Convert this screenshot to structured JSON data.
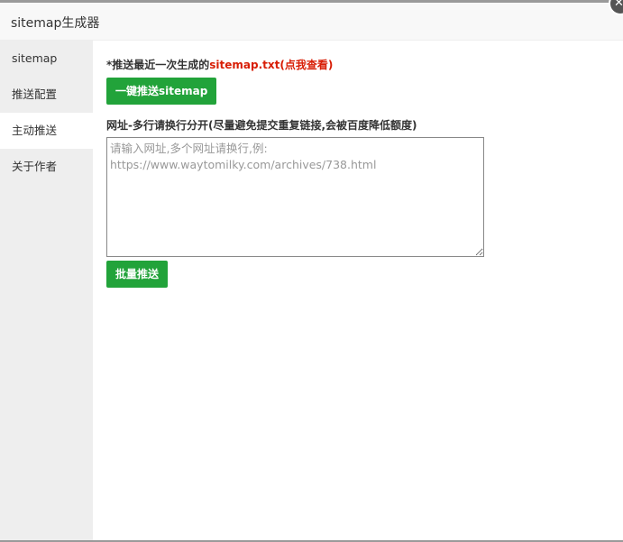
{
  "header": {
    "title": "sitemap生成器",
    "close_icon": "close-icon"
  },
  "sidebar": {
    "items": [
      {
        "label": "sitemap",
        "active": false
      },
      {
        "label": "推送配置",
        "active": false
      },
      {
        "label": "主动推送",
        "active": true
      },
      {
        "label": "关于作者",
        "active": false
      }
    ]
  },
  "main": {
    "note_prefix": "*推送最近一次生成的",
    "note_link": "sitemap.txt(点我查看)",
    "push_sitemap_label": "一键推送sitemap",
    "urls_label": "网址-多行请换行分开(尽量避免提交重复链接,会被百度降低额度)",
    "urls_value": "",
    "urls_placeholder": "请输入网址,多个网址请换行,例:\nhttps://www.waytomilky.com/archives/738.html",
    "batch_push_label": "批量推送"
  },
  "colors": {
    "accent": "#22a33a",
    "link": "#d81e06"
  }
}
